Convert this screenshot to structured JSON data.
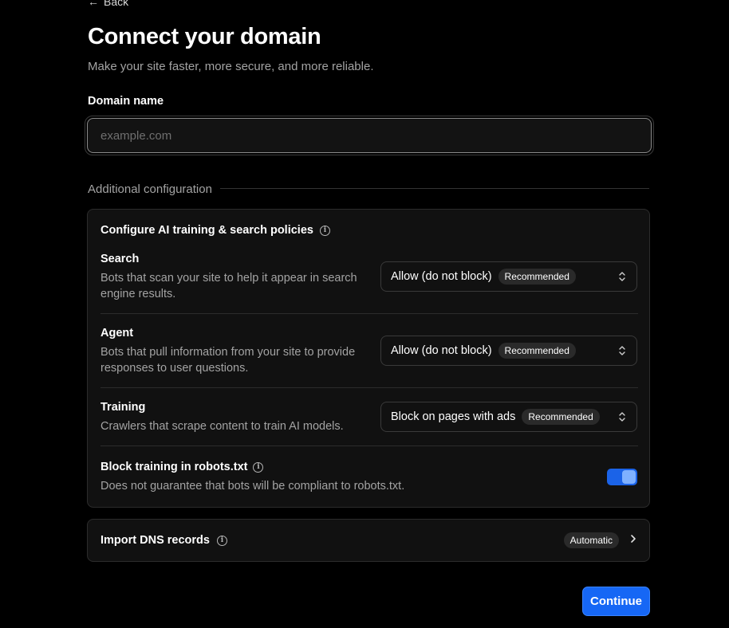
{
  "nav": {
    "back_label": "Back"
  },
  "header": {
    "title": "Connect your domain",
    "subtitle": "Make your site faster, more secure, and more reliable."
  },
  "domain": {
    "label": "Domain name",
    "value": "",
    "placeholder": "example.com"
  },
  "additional": {
    "heading": "Additional configuration",
    "policies_card": {
      "title": "Configure AI training & search policies",
      "rows": [
        {
          "name": "Search",
          "description": "Bots that scan your site to help it appear in search engine results.",
          "selected": "Allow (do not block)",
          "badge": "Recommended"
        },
        {
          "name": "Agent",
          "description": "Bots that pull information from your site to provide responses to user questions.",
          "selected": "Allow (do not block)",
          "badge": "Recommended"
        },
        {
          "name": "Training",
          "description": "Crawlers that scrape content to train AI models.",
          "selected": "Block on pages with ads",
          "badge": "Recommended"
        }
      ],
      "robots": {
        "title": "Block training in robots.txt",
        "description": "Does not guarantee that bots will be compliant to robots.txt.",
        "enabled": true
      }
    },
    "dns": {
      "title": "Import DNS records",
      "badge": "Automatic"
    }
  },
  "footer": {
    "continue_label": "Continue"
  },
  "colors": {
    "background": "#000000",
    "card": "#111111",
    "accent": "#1667f5",
    "muted_text": "#a3a3a3"
  },
  "icons": {
    "back": "arrow-left-icon",
    "info": "info-circle-icon",
    "select": "chevron-up-down-icon",
    "dns": "chevron-right-icon"
  }
}
